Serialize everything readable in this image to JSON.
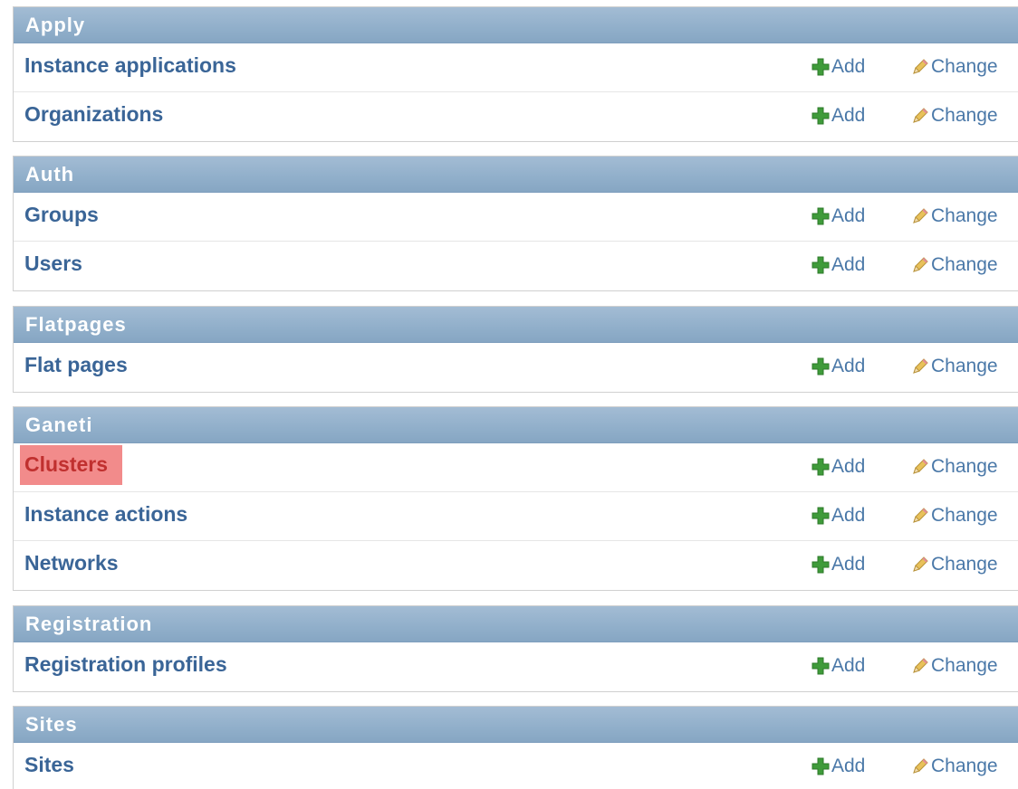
{
  "actions": {
    "add_label": "Add",
    "change_label": "Change",
    "add_icon": "plus-icon",
    "change_icon": "pencil-icon"
  },
  "colors": {
    "header_bg": "#92b0cb",
    "link": "#3a6597",
    "highlight_bg": "#f28b8b",
    "highlight_text": "#c0302f",
    "add_icon": "#3f9b3a",
    "pencil": "#e8c15a"
  },
  "modules": [
    {
      "title": "Apply",
      "models": [
        {
          "label": "Instance applications"
        },
        {
          "label": "Organizations"
        }
      ]
    },
    {
      "title": "Auth",
      "models": [
        {
          "label": "Groups"
        },
        {
          "label": "Users"
        }
      ]
    },
    {
      "title": "Flatpages",
      "models": [
        {
          "label": "Flat pages"
        }
      ]
    },
    {
      "title": "Ganeti",
      "models": [
        {
          "label": "Clusters",
          "highlighted": true
        },
        {
          "label": "Instance actions"
        },
        {
          "label": "Networks"
        }
      ]
    },
    {
      "title": "Registration",
      "models": [
        {
          "label": "Registration profiles"
        }
      ]
    },
    {
      "title": "Sites",
      "models": [
        {
          "label": "Sites"
        }
      ]
    }
  ]
}
